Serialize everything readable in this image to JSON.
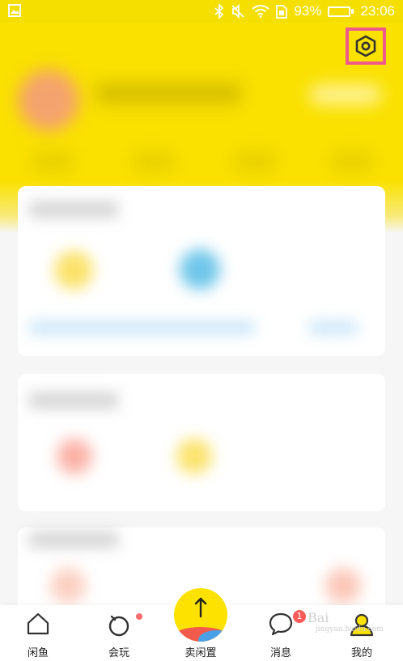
{
  "status_bar": {
    "battery_text": "93%",
    "time": "23:06",
    "battery_level": 0.93
  },
  "header": {
    "settings_icon": "settings-icon"
  },
  "tabs": [
    {
      "label": "闲鱼",
      "icon": "home-icon"
    },
    {
      "label": "会玩",
      "icon": "circle-icon",
      "has_dot": true
    },
    {
      "label": "卖闲置",
      "icon": "sell-plus-icon"
    },
    {
      "label": "消息",
      "icon": "chat-icon",
      "badge": "1"
    },
    {
      "label": "我的",
      "icon": "profile-icon"
    }
  ],
  "watermark": {
    "text": "Bai",
    "sub": "jingyan.baidu.com"
  },
  "colors": {
    "brand_yellow": "#fae100",
    "highlight_border": "#ee5a8c",
    "badge_red": "#ff5b5b"
  }
}
